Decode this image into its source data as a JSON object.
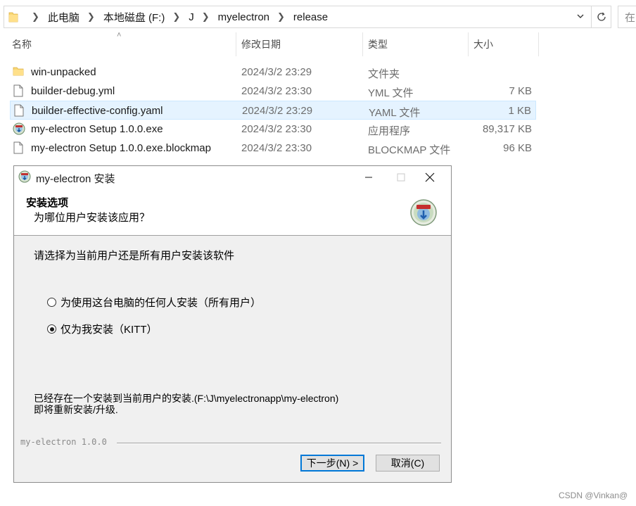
{
  "address_bar": {
    "breadcrumbs": [
      "此电脑",
      "本地磁盘 (F:)",
      "J",
      "myelectron",
      "release"
    ],
    "search_placeholder": "在"
  },
  "columns": {
    "name": "名称",
    "date": "修改日期",
    "type": "类型",
    "size": "大小"
  },
  "files": [
    {
      "name": "win-unpacked",
      "date": "2024/3/2 23:29",
      "type": "文件夹",
      "size": "",
      "icon": "folder-icon"
    },
    {
      "name": "builder-debug.yml",
      "date": "2024/3/2 23:30",
      "type": "YML 文件",
      "size": "7 KB",
      "icon": "file-icon"
    },
    {
      "name": "builder-effective-config.yaml",
      "date": "2024/3/2 23:29",
      "type": "YAML 文件",
      "size": "1 KB",
      "icon": "file-icon",
      "selected": true
    },
    {
      "name": "my-electron Setup 1.0.0.exe",
      "date": "2024/3/2 23:30",
      "type": "应用程序",
      "size": "89,317 KB",
      "icon": "installer-icon"
    },
    {
      "name": "my-electron Setup 1.0.0.exe.blockmap",
      "date": "2024/3/2 23:30",
      "type": "BLOCKMAP 文件",
      "size": "96 KB",
      "icon": "file-icon"
    }
  ],
  "dialog": {
    "title": "my-electron 安装",
    "header_title": "安装选项",
    "header_subtitle": "为哪位用户安装该应用？",
    "instruction": "请选择为当前用户还是所有用户安装该软件",
    "options": [
      {
        "label": "为使用这台电脑的任何人安装（所有用户）",
        "checked": false
      },
      {
        "label": "仅为我安装（KITT）",
        "checked": true
      }
    ],
    "note_line1": "已经存在一个安装到当前用户的安装.(F:\\J\\myelectronapp\\my-electron)",
    "note_line2": "即将重新安装/升级.",
    "branding": "my-electron 1.0.0",
    "next_button": "下一步(N) >",
    "cancel_button": "取消(C)"
  },
  "watermark": "CSDN @Vinkan@"
}
